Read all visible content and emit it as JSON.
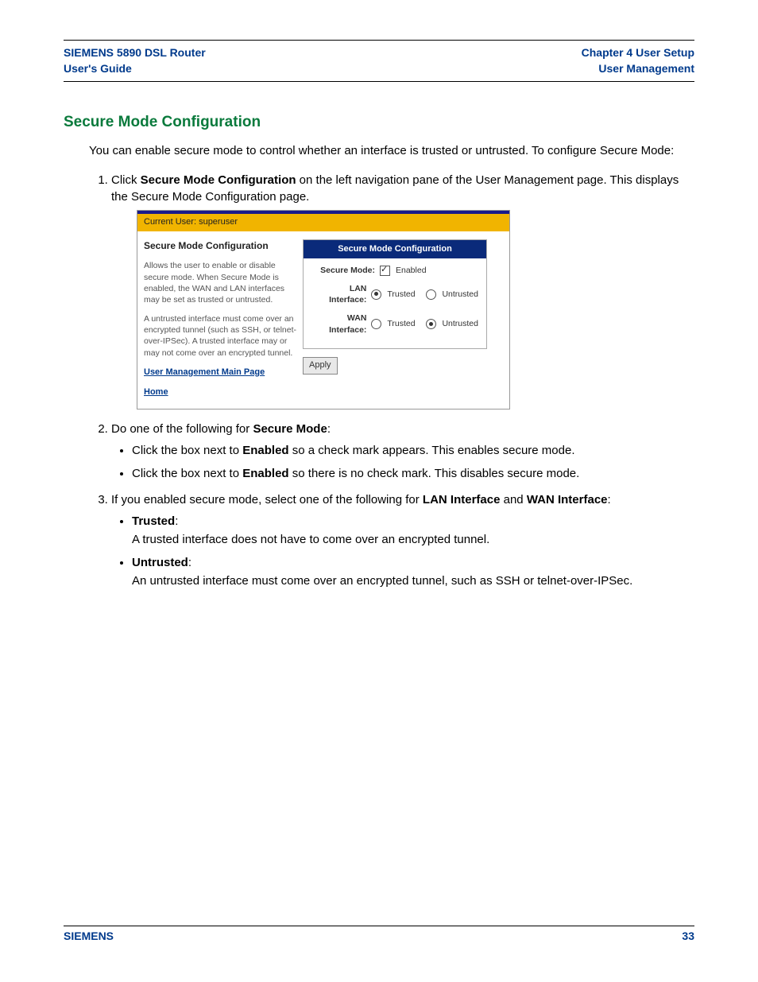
{
  "header": {
    "left1": "SIEMENS 5890 DSL Router",
    "left2": "User's Guide",
    "right1": "Chapter 4  User Setup",
    "right2": "User Management"
  },
  "title": "Secure Mode Configuration",
  "intro": "You can enable secure mode to control whether an interface is trusted or untrusted. To configure Secure Mode:",
  "step1_a": "Click ",
  "step1_b": "Secure Mode Configuration",
  "step1_c": " on the left navigation pane of the User Management page. This displays the Secure Mode Configuration page.",
  "shot": {
    "goldbar": "Current User: superuser",
    "left_title": "Secure Mode Configuration",
    "left_p1": "Allows the user to enable or disable secure mode. When Secure Mode is enabled, the WAN and LAN interfaces may be set as trusted or untrusted.",
    "left_p2": "A untrusted interface must come over an encrypted tunnel (such as SSH, or telnet-over-IPSec). A trusted interface may or may not come over an encrypted tunnel.",
    "link1": "User Management Main Page",
    "link2": "Home",
    "panel_title": "Secure Mode Configuration",
    "row1_lbl": "Secure Mode:",
    "row1_opt": "Enabled",
    "row2_lbl": "LAN Interface:",
    "row3_lbl": "WAN Interface:",
    "opt_trusted": "Trusted",
    "opt_untrusted": "Untrusted",
    "apply": "Apply"
  },
  "step2_a": "Do one of the following for ",
  "step2_b": "Secure Mode",
  "step2_c": ":",
  "step2_bullet1_a": "Click the box next to ",
  "step2_bullet1_b": "Enabled",
  "step2_bullet1_c": " so a check mark appears. This enables secure mode.",
  "step2_bullet2_a": "Click the box next to ",
  "step2_bullet2_b": "Enabled",
  "step2_bullet2_c": " so there is no check mark. This disables secure mode.",
  "step3_a": "If you enabled secure mode, select one of the following for ",
  "step3_b": "LAN Interface",
  "step3_c": " and ",
  "step3_d": "WAN Interface",
  "step3_e": ":",
  "step3_trusted_h": "Trusted",
  "step3_trusted_t": "A trusted interface does not have to come over an encrypted tunnel.",
  "step3_untrusted_h": "Untrusted",
  "step3_untrusted_t": "An untrusted interface must come over an encrypted tunnel, such as SSH or telnet-over-IPSec.",
  "footer": {
    "left": "SIEMENS",
    "right": "33"
  }
}
